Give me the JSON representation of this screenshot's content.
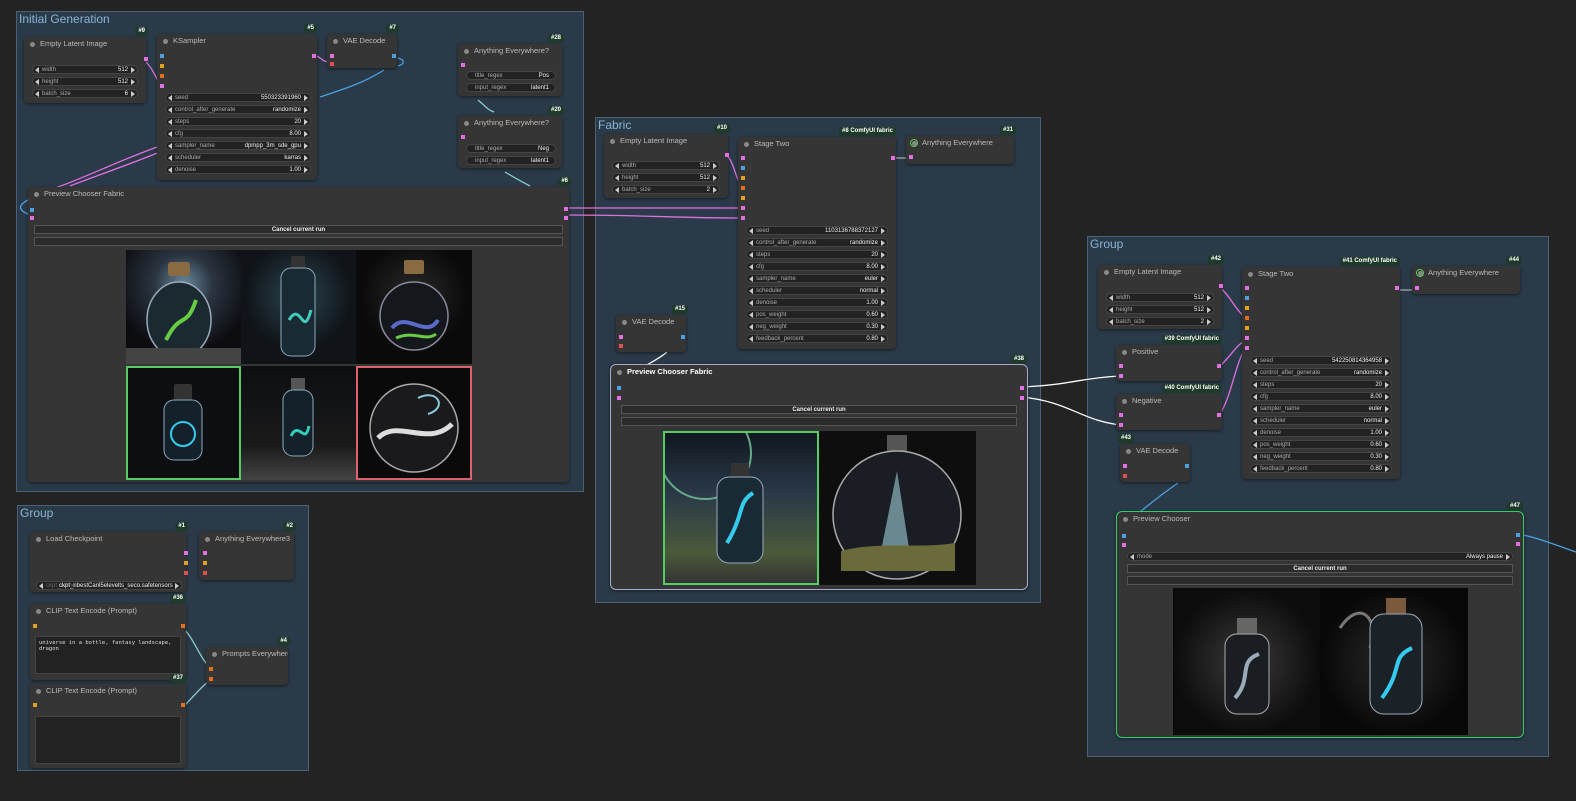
{
  "groups": {
    "initial": "Initial Generation",
    "fabric": "Fabric",
    "group_right": "Group",
    "group_left": "Group"
  },
  "nodes": {
    "n9": {
      "badge": "#9",
      "title": "Empty Latent Image",
      "width": "512",
      "height": "512",
      "batch_size": "6"
    },
    "n5": {
      "badge": "#5",
      "title": "KSampler",
      "seed": "550323391960",
      "control": "randomize",
      "steps": "20",
      "cfg": "8.00",
      "sampler": "dpmpp_3m_sde_gpu",
      "scheduler": "karras",
      "denoise": "1.00"
    },
    "n7": {
      "badge": "#7",
      "title": "VAE Decode"
    },
    "n28": {
      "badge": "#28",
      "title": "Anything Everywhere?",
      "title_regex": "Pos",
      "input_regex": "latent1"
    },
    "n20": {
      "badge": "#20",
      "title": "Anything Everywhere?",
      "title_regex": "Neg",
      "input_regex": "latent1"
    },
    "n6": {
      "badge": "#6",
      "title": "Preview Chooser Fabric",
      "cancel": "Cancel current run"
    },
    "n10": {
      "badge": "#10",
      "title": "Empty Latent Image",
      "width": "512",
      "height": "512",
      "batch_size": "2"
    },
    "n8": {
      "badge": "#8 ComfyUI fabric",
      "title": "Stage Two",
      "seed": "1103136788372127",
      "control": "randomize",
      "steps": "20",
      "cfg": "8.00",
      "sampler": "euler",
      "scheduler": "normal",
      "denoise": "1.00",
      "pos_weight": "0.60",
      "neg_weight": "0.30",
      "feedback": "0.80"
    },
    "n31": {
      "badge": "#31",
      "title": "Anything Everywhere"
    },
    "n15": {
      "badge": "#15",
      "title": "VAE Decode"
    },
    "n38": {
      "badge": "#38",
      "title": "Preview Chooser Fabric",
      "cancel": "Cancel current run"
    },
    "n42": {
      "badge": "#42",
      "title": "Empty Latent Image",
      "width": "512",
      "height": "512",
      "batch_size": "2"
    },
    "n41": {
      "badge": "#41 ComfyUI fabric",
      "title": "Stage Two",
      "seed": "542250814364958",
      "control": "randomize",
      "steps": "20",
      "cfg": "8.00",
      "sampler": "euler",
      "scheduler": "normal",
      "denoise": "1.00",
      "pos_weight": "0.60",
      "neg_weight": "0.30",
      "feedback": "0.80"
    },
    "n44": {
      "badge": "#44",
      "title": "Anything Everywhere"
    },
    "n39": {
      "badge": "#39 ComfyUI fabric",
      "title": "Positive"
    },
    "n40": {
      "badge": "#40 ComfyUI fabric",
      "title": "Negative"
    },
    "n43": {
      "badge": "#43",
      "title": "VAE Decode"
    },
    "n47": {
      "badge": "#47",
      "title": "Preview Chooser",
      "mode": "Always pause",
      "cancel": "Cancel current run"
    },
    "n1": {
      "badge": "#1",
      "title": "Load Checkpoint",
      "ckpt": "ckpt_nbestCanl5elevelts_seco.safetensors"
    },
    "n2": {
      "badge": "#2",
      "title": "Anything Everywhere3"
    },
    "n36": {
      "badge": "#36",
      "title": "CLIP Text Encode (Prompt)",
      "text": "universe in a bottle, fantasy landscape, dragon"
    },
    "n4": {
      "badge": "#4",
      "title": "Prompts Everywhere"
    },
    "n37": {
      "badge": "#37",
      "title": "CLIP Text Encode (Prompt)",
      "text": ""
    }
  },
  "labels": {
    "width": "width",
    "height": "height",
    "batch_size": "batch_size",
    "seed": "seed",
    "control": "control_after_generate",
    "steps": "steps",
    "cfg": "cfg",
    "sampler": "sampler_name",
    "scheduler": "scheduler",
    "denoise": "denoise",
    "pos_weight": "pos_weight",
    "neg_weight": "neg_weight",
    "feedback": "feedback_percent",
    "title_regex": "title_regex",
    "input_regex": "input_regex",
    "mode": "mode",
    "ckpt": "ckpt_name"
  },
  "colors": {
    "canvas": "#232323",
    "group": "#2a3a48",
    "node": "#353535",
    "selected_green": "#55cc66",
    "selected_red": "#e06070",
    "wire_pink": "#e070e0",
    "wire_blue": "#4aa0e0"
  }
}
